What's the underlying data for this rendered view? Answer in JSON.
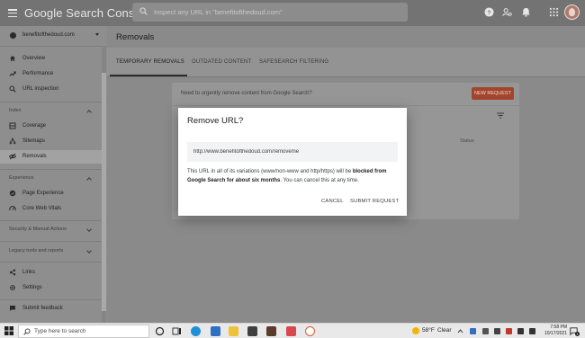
{
  "header": {
    "app_title": "Google Search Console",
    "search_placeholder": "Inspect any URL in \"benefitofthedoud.com\""
  },
  "sidebar": {
    "property": "benefitofthedoud.com",
    "items": [
      {
        "label": "Overview",
        "icon": "home-icon"
      },
      {
        "label": "Performance",
        "icon": "trending-icon"
      },
      {
        "label": "URL inspection",
        "icon": "search-icon"
      }
    ],
    "index_section": "Index",
    "index_items": [
      {
        "label": "Coverage",
        "icon": "coverage-icon"
      },
      {
        "label": "Sitemaps",
        "icon": "sitemap-icon"
      },
      {
        "label": "Removals",
        "icon": "removals-icon",
        "active": true
      }
    ],
    "experience_section": "Experience",
    "experience_items": [
      {
        "label": "Page Experience",
        "icon": "page-experience-icon"
      },
      {
        "label": "Core Web Vitals",
        "icon": "speed-icon"
      }
    ],
    "security_section": "Security & Manual Actions",
    "legacy_section": "Legacy tools and reports",
    "bottom_items": [
      {
        "label": "Links",
        "icon": "links-icon"
      },
      {
        "label": "Settings",
        "icon": "gear-icon"
      }
    ],
    "feedback_label": "Submit feedback"
  },
  "main": {
    "page_title": "Removals",
    "tabs": [
      "TEMPORARY REMOVALS",
      "OUTDATED CONTENT",
      "SAFESEARCH FILTERING"
    ],
    "active_tab": 0,
    "card_prompt": "Need to urgently remove content from Google Search?",
    "new_request_label": "NEW REQUEST",
    "status_column": "Status"
  },
  "dialog": {
    "title": "Remove URL?",
    "url_value": "http://www.benefitofthedoud.com/removeme",
    "body_pre": "This URL in all of its variations (www/non-www and http/https) will be ",
    "body_bold": "blocked from Google Search for about six months",
    "body_post": ". You can cancel this at any time.",
    "cancel_label": "CANCEL",
    "submit_label": "SUBMIT REQUEST"
  },
  "taskbar": {
    "search_placeholder": "Type here to search",
    "weather_temp": "58°F",
    "weather_desc": "Clear",
    "time": "7:58 PM",
    "date": "10/17/2021",
    "notification_count": "1"
  },
  "colors": {
    "accent": "#a3452c",
    "active_tab_underline": "#2b2b2b",
    "dialog_bg": "#ffffff"
  }
}
